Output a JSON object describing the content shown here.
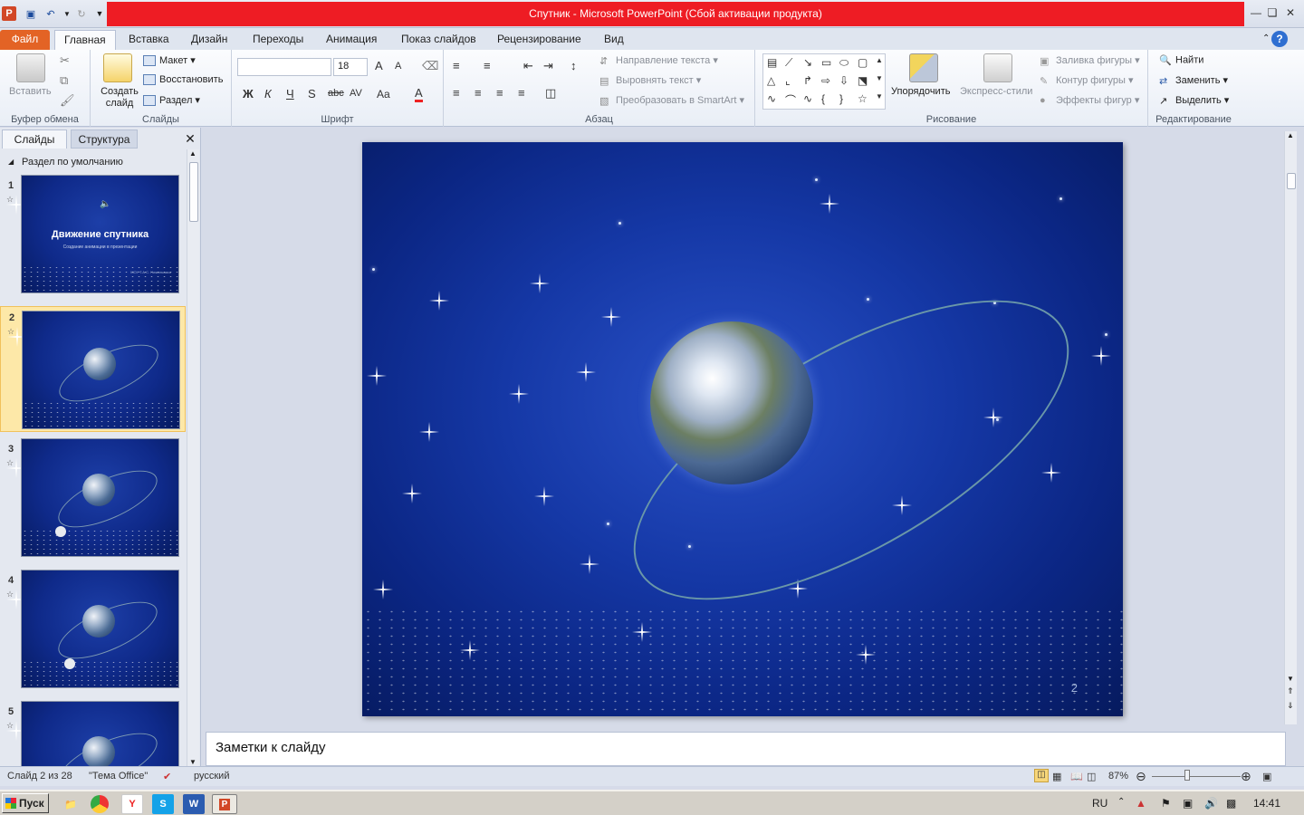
{
  "window": {
    "title": "Спутник - Microsoft PowerPoint (Сбой активации продукта)"
  },
  "ribbon": {
    "tabs": [
      "Файл",
      "Главная",
      "Вставка",
      "Дизайн",
      "Переходы",
      "Анимация",
      "Показ слайдов",
      "Рецензирование",
      "Вид"
    ],
    "clipboard": {
      "label": "Буфер обмена",
      "paste": "Вставить"
    },
    "slides": {
      "label": "Слайды",
      "new_slide": "Создать слайд",
      "layout": "Макет",
      "reset": "Восстановить",
      "section": "Раздел"
    },
    "font": {
      "label": "Шрифт",
      "size": "18",
      "bold": "Ж",
      "italic": "К",
      "underline": "Ч",
      "shadow": "S",
      "strike": "abc",
      "spacing": "AV",
      "case": "Aa",
      "color": "A",
      "grow": "A",
      "shrink": "A"
    },
    "paragraph": {
      "label": "Абзац",
      "text_direction": "Направление текста",
      "align_text": "Выровнять текст",
      "smartart": "Преобразовать в SmartArt"
    },
    "drawing": {
      "label": "Рисование",
      "arrange": "Упорядочить",
      "quick_styles": "Экспресс-стили",
      "fill": "Заливка фигуры",
      "outline": "Контур фигуры",
      "effects": "Эффекты фигур"
    },
    "editing": {
      "label": "Редактирование",
      "find": "Найти",
      "replace": "Заменить",
      "select": "Выделить"
    }
  },
  "leftpane": {
    "tab_slides": "Слайды",
    "tab_outline": "Структура",
    "section_name": "Раздел по умолчанию",
    "thumbs": [
      {
        "num": "1",
        "title": "Движение спутника",
        "subtitle": "Создание анимации в презентации",
        "footer": "МОУ Т.А.С. Нижнекамск"
      },
      {
        "num": "2"
      },
      {
        "num": "3"
      },
      {
        "num": "4"
      },
      {
        "num": "5"
      }
    ]
  },
  "slide": {
    "number": "2"
  },
  "notes": {
    "placeholder": "Заметки к слайду"
  },
  "status": {
    "slide_info": "Слайд 2 из 28",
    "theme": "\"Тема Office\"",
    "language": "русский",
    "zoom": "87%"
  },
  "taskbar": {
    "start": "Пуск",
    "lang": "RU",
    "clock": "14:41",
    "apps": [
      "folder",
      "chrome",
      "yandex",
      "skype",
      "word",
      "powerpoint"
    ]
  },
  "colors": {
    "accent_red": "#ee1c24",
    "file_tab": "#e36325",
    "slide_bg": "#0b2684",
    "orbit": "#6a97a8"
  }
}
